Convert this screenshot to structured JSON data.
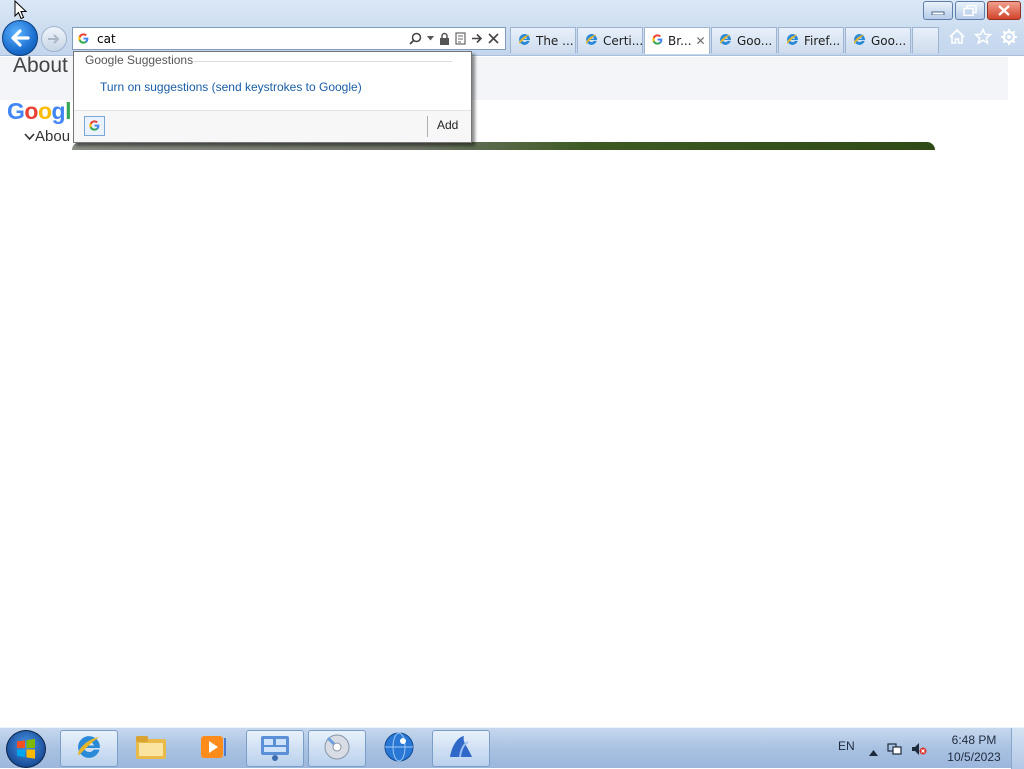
{
  "window": {
    "controls": [
      "minimize",
      "restore",
      "close"
    ]
  },
  "addressbar": {
    "value": "cat",
    "provider_icon": "google-g-icon"
  },
  "tabs": [
    {
      "label": "The ...",
      "icon": "ie-icon",
      "active": false
    },
    {
      "label": "Certi...",
      "icon": "ie-icon",
      "active": false
    },
    {
      "label": "Br...",
      "icon": "google-g-icon",
      "active": true,
      "close": "✕"
    },
    {
      "label": "Goo...",
      "icon": "ie-icon",
      "active": false
    },
    {
      "label": "Firef...",
      "icon": "ie-icon",
      "active": false
    },
    {
      "label": "Goo...",
      "icon": "ie-icon",
      "active": false
    }
  ],
  "page": {
    "title": "About",
    "logo": "Googl",
    "nav_label": "Abou"
  },
  "dropdown": {
    "heading": "Google Suggestions",
    "link": "Turn on suggestions (send keystrokes to Google)",
    "add_label": "Add"
  },
  "taskbar": {
    "language": "EN",
    "time": "6:48 PM",
    "date": "10/5/2023"
  },
  "colors": {
    "link": "#1a5ea8",
    "chrome": "#cbdcf0",
    "taskbar": "#a9c2e2"
  }
}
